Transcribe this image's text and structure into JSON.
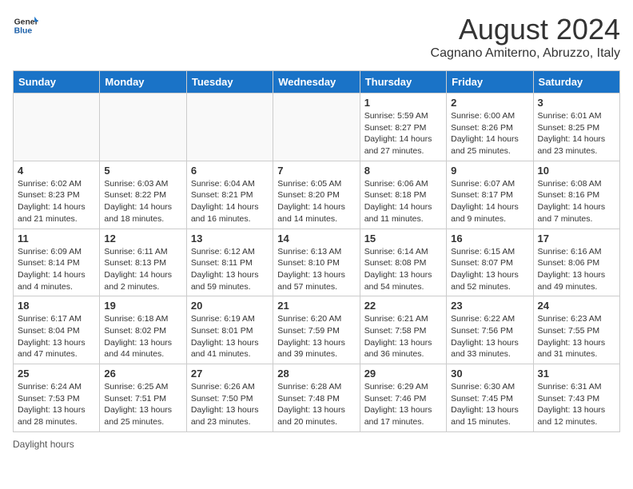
{
  "header": {
    "logo_line1": "General",
    "logo_line2": "Blue",
    "month_year": "August 2024",
    "location": "Cagnano Amiterno, Abruzzo, Italy"
  },
  "days_of_week": [
    "Sunday",
    "Monday",
    "Tuesday",
    "Wednesday",
    "Thursday",
    "Friday",
    "Saturday"
  ],
  "weeks": [
    [
      {
        "day": "",
        "info": ""
      },
      {
        "day": "",
        "info": ""
      },
      {
        "day": "",
        "info": ""
      },
      {
        "day": "",
        "info": ""
      },
      {
        "day": "1",
        "info": "Sunrise: 5:59 AM\nSunset: 8:27 PM\nDaylight: 14 hours and 27 minutes."
      },
      {
        "day": "2",
        "info": "Sunrise: 6:00 AM\nSunset: 8:26 PM\nDaylight: 14 hours and 25 minutes."
      },
      {
        "day": "3",
        "info": "Sunrise: 6:01 AM\nSunset: 8:25 PM\nDaylight: 14 hours and 23 minutes."
      }
    ],
    [
      {
        "day": "4",
        "info": "Sunrise: 6:02 AM\nSunset: 8:23 PM\nDaylight: 14 hours and 21 minutes."
      },
      {
        "day": "5",
        "info": "Sunrise: 6:03 AM\nSunset: 8:22 PM\nDaylight: 14 hours and 18 minutes."
      },
      {
        "day": "6",
        "info": "Sunrise: 6:04 AM\nSunset: 8:21 PM\nDaylight: 14 hours and 16 minutes."
      },
      {
        "day": "7",
        "info": "Sunrise: 6:05 AM\nSunset: 8:20 PM\nDaylight: 14 hours and 14 minutes."
      },
      {
        "day": "8",
        "info": "Sunrise: 6:06 AM\nSunset: 8:18 PM\nDaylight: 14 hours and 11 minutes."
      },
      {
        "day": "9",
        "info": "Sunrise: 6:07 AM\nSunset: 8:17 PM\nDaylight: 14 hours and 9 minutes."
      },
      {
        "day": "10",
        "info": "Sunrise: 6:08 AM\nSunset: 8:16 PM\nDaylight: 14 hours and 7 minutes."
      }
    ],
    [
      {
        "day": "11",
        "info": "Sunrise: 6:09 AM\nSunset: 8:14 PM\nDaylight: 14 hours and 4 minutes."
      },
      {
        "day": "12",
        "info": "Sunrise: 6:11 AM\nSunset: 8:13 PM\nDaylight: 14 hours and 2 minutes."
      },
      {
        "day": "13",
        "info": "Sunrise: 6:12 AM\nSunset: 8:11 PM\nDaylight: 13 hours and 59 minutes."
      },
      {
        "day": "14",
        "info": "Sunrise: 6:13 AM\nSunset: 8:10 PM\nDaylight: 13 hours and 57 minutes."
      },
      {
        "day": "15",
        "info": "Sunrise: 6:14 AM\nSunset: 8:08 PM\nDaylight: 13 hours and 54 minutes."
      },
      {
        "day": "16",
        "info": "Sunrise: 6:15 AM\nSunset: 8:07 PM\nDaylight: 13 hours and 52 minutes."
      },
      {
        "day": "17",
        "info": "Sunrise: 6:16 AM\nSunset: 8:06 PM\nDaylight: 13 hours and 49 minutes."
      }
    ],
    [
      {
        "day": "18",
        "info": "Sunrise: 6:17 AM\nSunset: 8:04 PM\nDaylight: 13 hours and 47 minutes."
      },
      {
        "day": "19",
        "info": "Sunrise: 6:18 AM\nSunset: 8:02 PM\nDaylight: 13 hours and 44 minutes."
      },
      {
        "day": "20",
        "info": "Sunrise: 6:19 AM\nSunset: 8:01 PM\nDaylight: 13 hours and 41 minutes."
      },
      {
        "day": "21",
        "info": "Sunrise: 6:20 AM\nSunset: 7:59 PM\nDaylight: 13 hours and 39 minutes."
      },
      {
        "day": "22",
        "info": "Sunrise: 6:21 AM\nSunset: 7:58 PM\nDaylight: 13 hours and 36 minutes."
      },
      {
        "day": "23",
        "info": "Sunrise: 6:22 AM\nSunset: 7:56 PM\nDaylight: 13 hours and 33 minutes."
      },
      {
        "day": "24",
        "info": "Sunrise: 6:23 AM\nSunset: 7:55 PM\nDaylight: 13 hours and 31 minutes."
      }
    ],
    [
      {
        "day": "25",
        "info": "Sunrise: 6:24 AM\nSunset: 7:53 PM\nDaylight: 13 hours and 28 minutes."
      },
      {
        "day": "26",
        "info": "Sunrise: 6:25 AM\nSunset: 7:51 PM\nDaylight: 13 hours and 25 minutes."
      },
      {
        "day": "27",
        "info": "Sunrise: 6:26 AM\nSunset: 7:50 PM\nDaylight: 13 hours and 23 minutes."
      },
      {
        "day": "28",
        "info": "Sunrise: 6:28 AM\nSunset: 7:48 PM\nDaylight: 13 hours and 20 minutes."
      },
      {
        "day": "29",
        "info": "Sunrise: 6:29 AM\nSunset: 7:46 PM\nDaylight: 13 hours and 17 minutes."
      },
      {
        "day": "30",
        "info": "Sunrise: 6:30 AM\nSunset: 7:45 PM\nDaylight: 13 hours and 15 minutes."
      },
      {
        "day": "31",
        "info": "Sunrise: 6:31 AM\nSunset: 7:43 PM\nDaylight: 13 hours and 12 minutes."
      }
    ]
  ],
  "footer": {
    "daylight_label": "Daylight hours"
  }
}
